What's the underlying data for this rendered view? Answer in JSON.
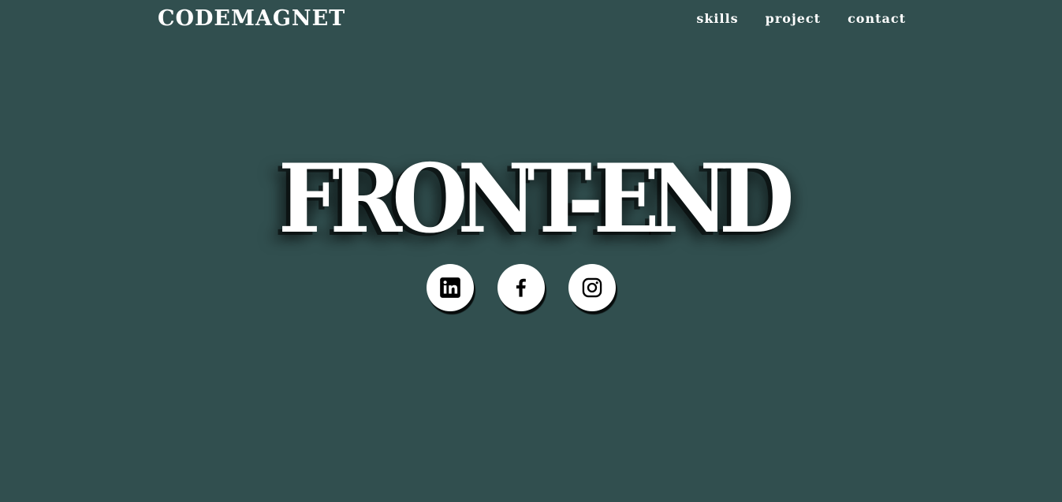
{
  "header": {
    "logo": "CODEMAGNET",
    "nav": [
      {
        "label": "skills"
      },
      {
        "label": "project"
      },
      {
        "label": "contact"
      }
    ]
  },
  "hero": {
    "title": "FRONT-END"
  },
  "socials": [
    {
      "icon": "linkedin-icon"
    },
    {
      "icon": "facebook-icon"
    },
    {
      "icon": "instagram-icon"
    }
  ],
  "colors": {
    "background": "#314f4f",
    "text": "#ffffff",
    "icon": "#000000"
  }
}
